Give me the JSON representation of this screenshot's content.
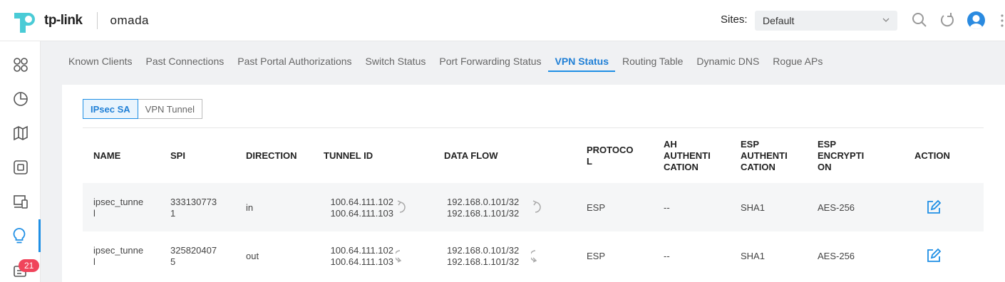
{
  "brand": {
    "name": "tp-link",
    "product": "omada"
  },
  "header": {
    "sites_label": "Sites:",
    "site_value": "Default"
  },
  "sidebar": {
    "badge_count": "21"
  },
  "tabs": [
    "Known Clients",
    "Past Connections",
    "Past Portal Authorizations",
    "Switch Status",
    "Port Forwarding Status",
    "VPN Status",
    "Routing Table",
    "Dynamic DNS",
    "Rogue APs"
  ],
  "active_tab": "VPN Status",
  "segment": {
    "ipsec_sa": "IPsec SA",
    "vpn_tunnel": "VPN Tunnel"
  },
  "table": {
    "headers": {
      "name": "NAME",
      "spi": "SPI",
      "direction": "DIRECTION",
      "tunnel_id": "TUNNEL ID",
      "data_flow": "DATA FLOW",
      "protocol_1": "PROTOCO",
      "protocol_2": "L",
      "ah_1": "AH",
      "ah_2": "AUTHENTI",
      "ah_3": "CATION",
      "esp_auth_1": "ESP",
      "esp_auth_2": "AUTHENTI",
      "esp_auth_3": "CATION",
      "esp_enc_1": "ESP",
      "esp_enc_2": "ENCRYPTI",
      "esp_enc_3": "ON",
      "action": "ACTION"
    },
    "rows": [
      {
        "name_1": "ipsec_tunne",
        "name_2": "l",
        "spi_1": "333130773",
        "spi_2": "1",
        "direction": "in",
        "tunnel_1": "100.64.111.102",
        "tunnel_2": "100.64.111.103",
        "flow_1": "192.168.0.101/32",
        "flow_2": "192.168.1.101/32",
        "protocol": "ESP",
        "ah": "--",
        "esp_auth": "SHA1",
        "esp_enc": "AES-256"
      },
      {
        "name_1": "ipsec_tunne",
        "name_2": "l",
        "spi_1": "325820407",
        "spi_2": "5",
        "direction": "out",
        "tunnel_1": "100.64.111.102",
        "tunnel_2": "100.64.111.103",
        "flow_1": "192.168.0.101/32",
        "flow_2": "192.168.1.101/32",
        "protocol": "ESP",
        "ah": "--",
        "esp_auth": "SHA1",
        "esp_enc": "AES-256"
      }
    ]
  },
  "colors": {
    "accent": "#1f8fe5",
    "brand_teal": "#4acbd6",
    "badge": "#f0445b"
  }
}
